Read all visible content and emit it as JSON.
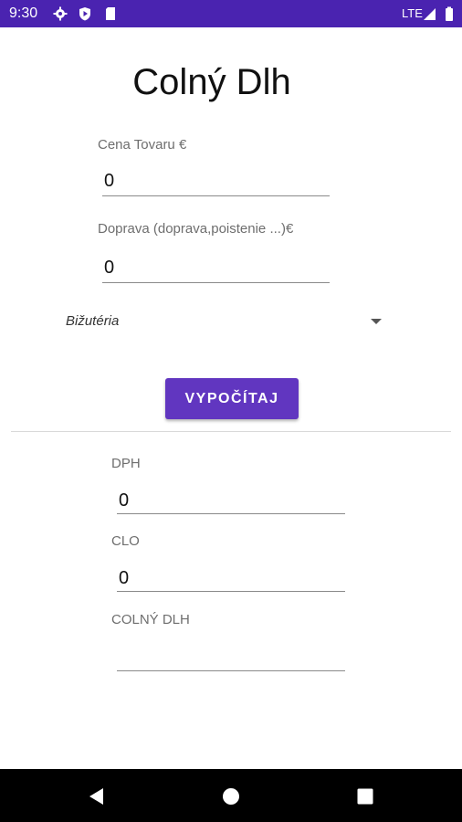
{
  "status_bar": {
    "time": "9:30",
    "network": "LTE",
    "bg_color": "#4a23b0"
  },
  "app": {
    "title": "Colný Dlh"
  },
  "inputs": {
    "price": {
      "label": "Cena Tovaru €",
      "value": "0"
    },
    "transport": {
      "label": "Doprava (doprava,poistenie ...)€",
      "value": "0"
    }
  },
  "category": {
    "selected": "Bižutéria"
  },
  "button": {
    "label": "VYPOČÍTAJ",
    "color": "#6136c0"
  },
  "results": {
    "vat": {
      "label": "DPH",
      "value": "0"
    },
    "duty": {
      "label": "CLO",
      "value": "0"
    },
    "customs_debt": {
      "label": "COLNÝ DLH",
      "value": ""
    }
  }
}
